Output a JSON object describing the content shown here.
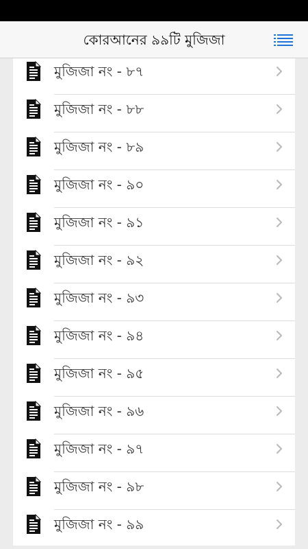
{
  "header": {
    "title": "কোরআনের ৯৯টি মুজিজা",
    "menu_icon": "list-menu-icon",
    "accent": "#1e73d8"
  },
  "items": [
    {
      "label": "মুজিজা নং - ৮৭"
    },
    {
      "label": "মুজিজা নং - ৮৮"
    },
    {
      "label": "মুজিজা নং - ৮৯"
    },
    {
      "label": "মুজিজা নং - ৯০"
    },
    {
      "label": "মুজিজা নং - ৯১"
    },
    {
      "label": "মুজিজা নং - ৯২"
    },
    {
      "label": "মুজিজা নং - ৯৩"
    },
    {
      "label": "মুজিজা নং - ৯৪"
    },
    {
      "label": "মুজিজা নং - ৯৫"
    },
    {
      "label": "মুজিজা নং - ৯৬"
    },
    {
      "label": "মুজিজা নং - ৯৭"
    },
    {
      "label": "মুজিজা নং - ৯৮"
    },
    {
      "label": "মুজিজা নং - ৯৯"
    }
  ],
  "icons": {
    "item_icon": "document-icon",
    "item_chevron": "chevron-right-icon"
  }
}
